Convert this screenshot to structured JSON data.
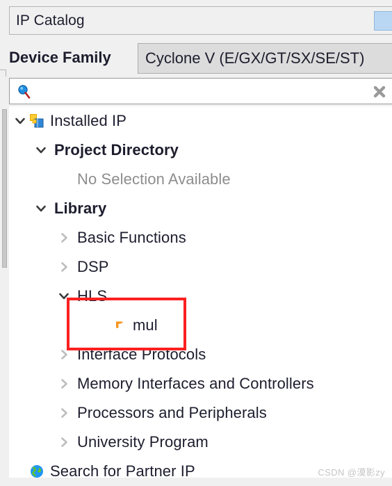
{
  "window": {
    "title": "IP Catalog"
  },
  "device_family": {
    "label": "Device Family",
    "selected": "Cyclone V (E/GX/GT/SX/SE/ST)"
  },
  "search": {
    "value": "",
    "placeholder": "",
    "search_icon": "search-icon",
    "clear_icon": "clear-x-icon"
  },
  "tree": {
    "rows": [
      {
        "label": "Installed IP",
        "level": 0,
        "twisty": "chevron-down",
        "icon": "installed-ip-icon",
        "bold": false,
        "muted": false
      },
      {
        "label": "Project Directory",
        "level": 1,
        "twisty": "chevron-down",
        "icon": "none",
        "bold": true,
        "muted": false
      },
      {
        "label": "No Selection Available",
        "level": 2,
        "twisty": "none",
        "icon": "none",
        "bold": false,
        "muted": true
      },
      {
        "label": "Library",
        "level": 1,
        "twisty": "chevron-down",
        "icon": "none",
        "bold": true,
        "muted": false
      },
      {
        "label": "Basic Functions",
        "level": 2,
        "twisty": "chevron-right",
        "icon": "none",
        "bold": false,
        "muted": false
      },
      {
        "label": "DSP",
        "level": 2,
        "twisty": "chevron-right",
        "icon": "none",
        "bold": false,
        "muted": false
      },
      {
        "label": "HLS",
        "level": 2,
        "twisty": "chevron-down",
        "icon": "none",
        "bold": false,
        "muted": false
      },
      {
        "label": "mul",
        "level": 3,
        "twisty": "none",
        "icon": "ip-core-icon",
        "bold": false,
        "muted": false
      },
      {
        "label": "Interface Protocols",
        "level": 2,
        "twisty": "chevron-right",
        "icon": "none",
        "bold": false,
        "muted": false
      },
      {
        "label": "Memory Interfaces and Controllers",
        "level": 2,
        "twisty": "chevron-right",
        "icon": "none",
        "bold": false,
        "muted": false
      },
      {
        "label": "Processors and Peripherals",
        "level": 2,
        "twisty": "chevron-right",
        "icon": "none",
        "bold": false,
        "muted": false
      },
      {
        "label": "University Program",
        "level": 2,
        "twisty": "chevron-right",
        "icon": "none",
        "bold": false,
        "muted": false
      },
      {
        "label": "Search for Partner IP",
        "level": 0,
        "twisty": "none",
        "icon": "globe-icon",
        "bold": false,
        "muted": false
      }
    ]
  },
  "annotation": {
    "highlight_color": "#fb2020",
    "highlight_target": "mul"
  },
  "watermark": {
    "text": "CSDN @漠影zy"
  },
  "colors": {
    "panel_bg": "#f0f0f0",
    "tree_bg": "#ffffff",
    "text": "#1d1d2e",
    "muted_text": "#8d8d8d",
    "accent_blue": "#b9d7f2",
    "twisty_gray": "#b0b0b0"
  }
}
